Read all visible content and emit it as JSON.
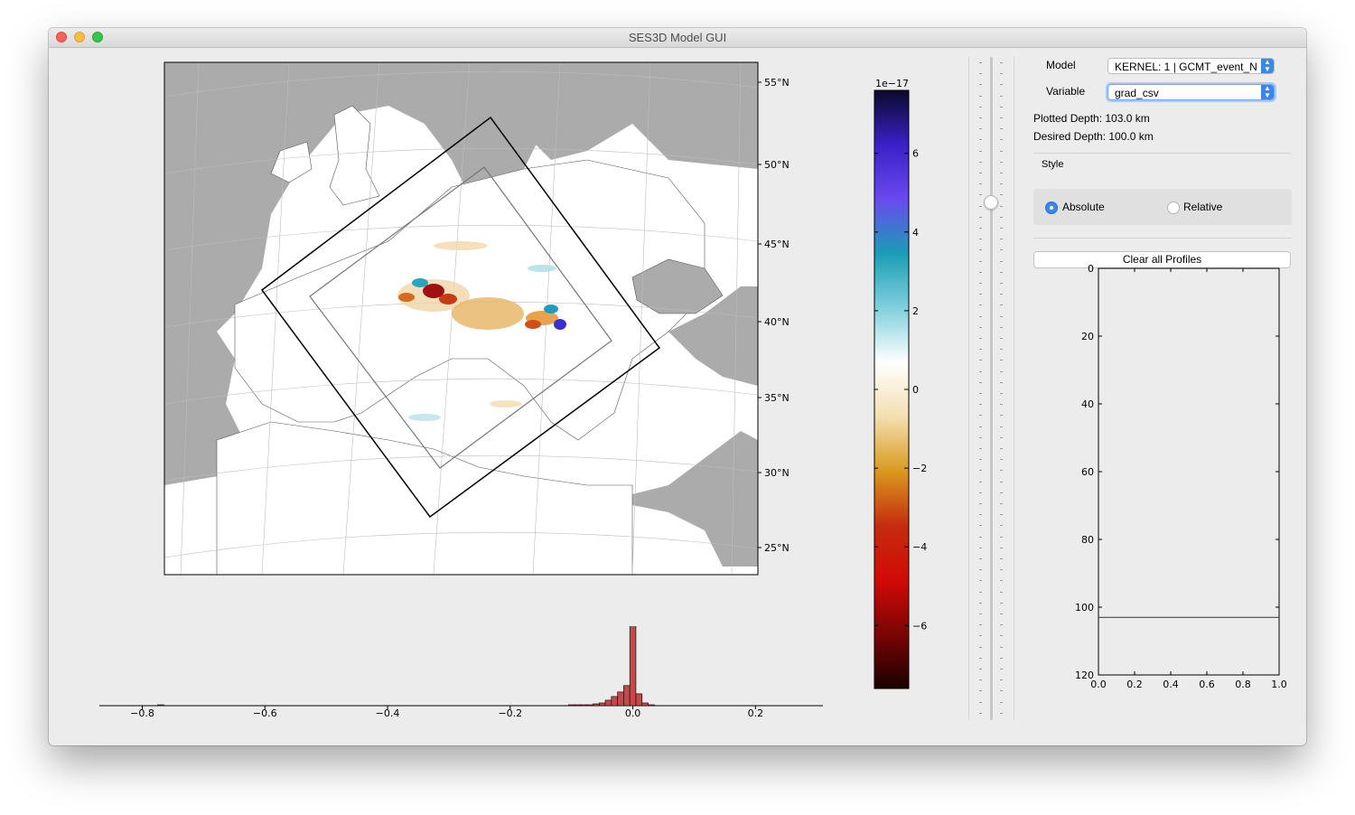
{
  "window": {
    "title": "SES3D Model GUI"
  },
  "map": {
    "lat_labels": [
      "55°N",
      "50°N",
      "45°N",
      "40°N",
      "35°N",
      "30°N",
      "25°N"
    ]
  },
  "colorbar": {
    "exponent_label": "1e−17",
    "tick_labels": [
      "6",
      "4",
      "2",
      "0",
      "−2",
      "−4",
      "−6"
    ],
    "colors": [
      "#0a0a2a",
      "#3a20c8",
      "#6a4af0",
      "#1b9db5",
      "#7fd0dd",
      "#ffffff",
      "#f3dfb0",
      "#d89a1e",
      "#c62c0e",
      "#d20a06",
      "#7a0505",
      "#1a0000"
    ]
  },
  "histogram": {
    "tick_labels": [
      "−0.8",
      "−0.6",
      "−0.4",
      "−0.2",
      "0.0",
      "0.2"
    ],
    "bar_color": "#c34a4a"
  },
  "controls": {
    "model_label": "Model",
    "model_value": "KERNEL: 1 | GCMT_event_N",
    "variable_label": "Variable",
    "variable_value": "grad_csv",
    "plotted_depth": "Plotted Depth: 103.0 km",
    "desired_depth": "Desired Depth: 100.0 km",
    "style_label": "Style",
    "style_options": [
      "Absolute",
      "Relative"
    ],
    "selected_style": "Absolute",
    "clear_button": "Clear all Profiles",
    "depth_slider_fraction": 0.22
  },
  "chart_data": [
    {
      "type": "bar",
      "title": "",
      "xlabel": "",
      "ylabel": "",
      "x_ticks": [
        "−0.8",
        "−0.6",
        "−0.4",
        "−0.2",
        "0.0",
        "0.2"
      ],
      "xlim": [
        -0.87,
        0.31
      ],
      "description_free_values": [
        {
          "x": -0.77,
          "h": 1
        },
        {
          "x": -0.1,
          "h": 1
        },
        {
          "x": -0.09,
          "h": 1
        },
        {
          "x": -0.08,
          "h": 1
        },
        {
          "x": -0.07,
          "h": 1
        },
        {
          "x": -0.06,
          "h": 2
        },
        {
          "x": -0.05,
          "h": 3
        },
        {
          "x": -0.04,
          "h": 6
        },
        {
          "x": -0.03,
          "h": 10
        },
        {
          "x": -0.02,
          "h": 15
        },
        {
          "x": -0.01,
          "h": 22
        },
        {
          "x": 0.0,
          "h": 100
        },
        {
          "x": 0.01,
          "h": 13
        },
        {
          "x": 0.02,
          "h": 3
        },
        {
          "x": 0.03,
          "h": 1
        }
      ]
    },
    {
      "type": "line",
      "title": "",
      "xlabel": "",
      "ylabel": "",
      "x_ticks": [
        "0.0",
        "0.2",
        "0.4",
        "0.6",
        "0.8",
        "1.0"
      ],
      "y_ticks": [
        "0",
        "20",
        "40",
        "60",
        "80",
        "100",
        "120"
      ],
      "xlim": [
        0,
        1
      ],
      "ylim": [
        120,
        0
      ],
      "series": [
        {
          "x": [
            0,
            1
          ],
          "y": [
            103,
            103
          ]
        }
      ]
    }
  ]
}
